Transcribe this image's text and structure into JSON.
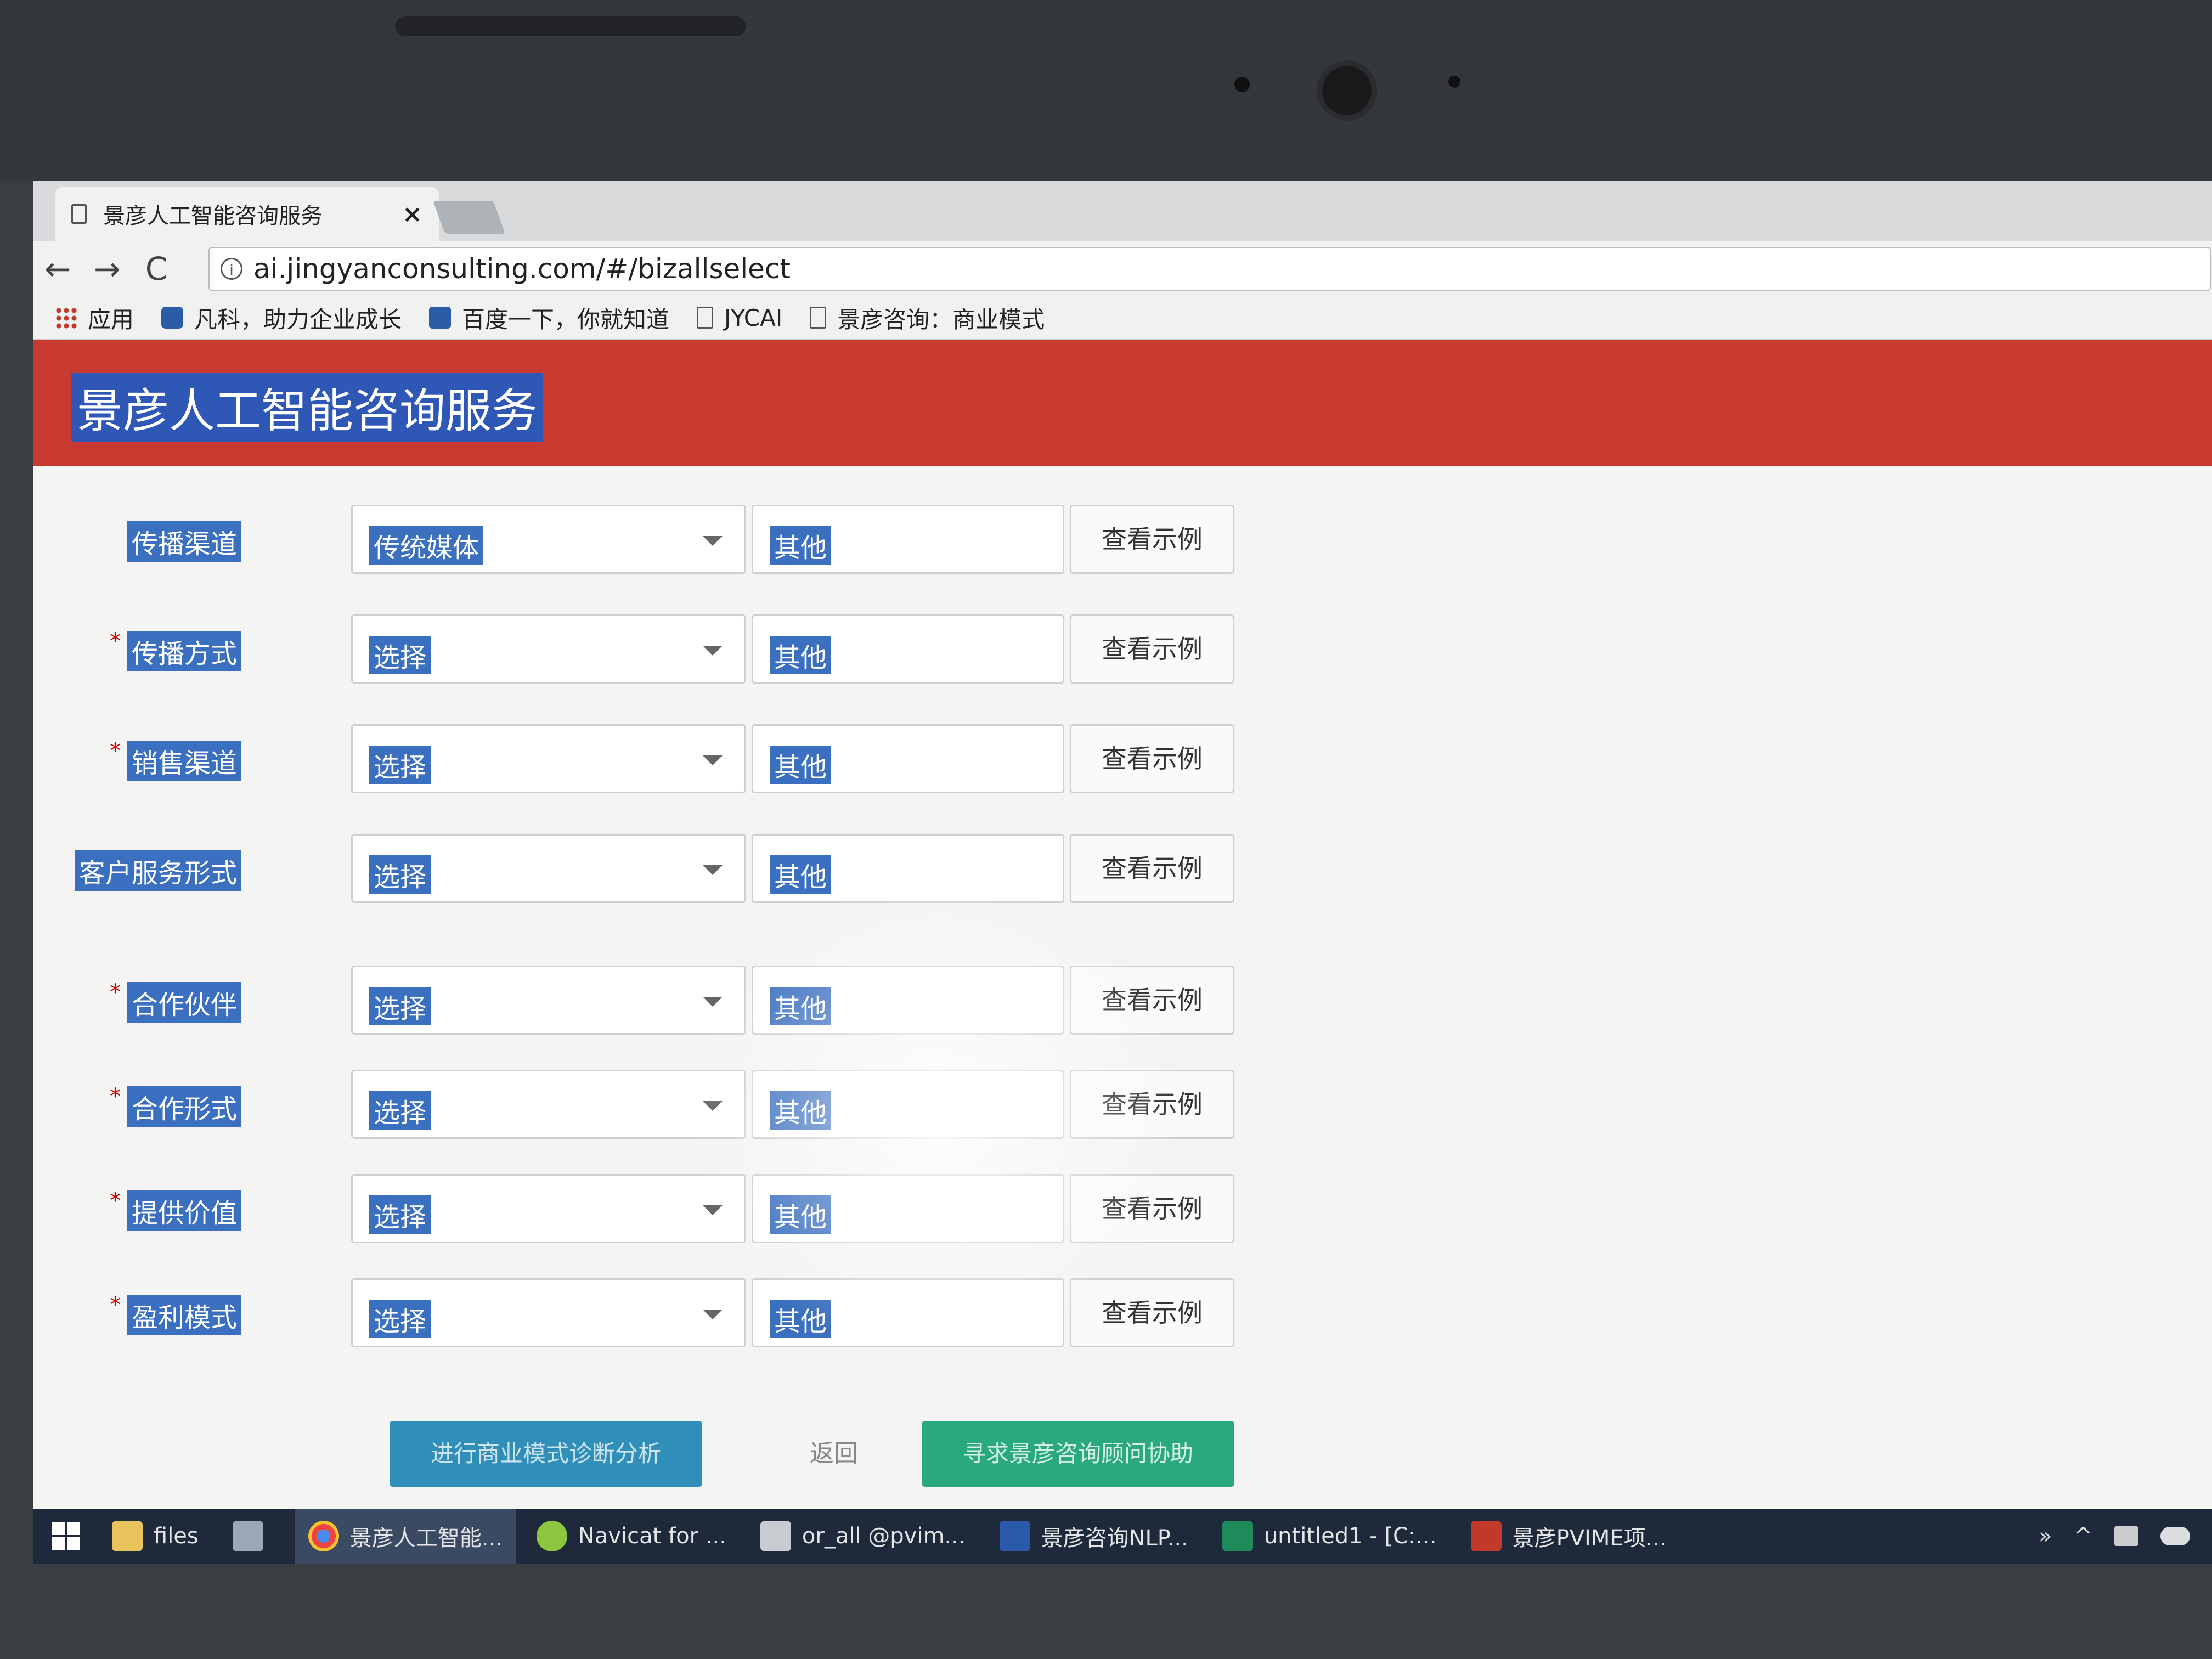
{
  "browser": {
    "tab_title": "景彦人工智能咨询服务",
    "tab_close": "×",
    "url": "ai.jingyanconsulting.com/#/bizallselect",
    "nav": {
      "back": "←",
      "forward": "→",
      "reload": "C"
    },
    "info_glyph": "i",
    "bookmarks": [
      {
        "label": "应用",
        "icon": "apps-grid-icon"
      },
      {
        "label": "凡科，助力企业成长",
        "icon": "fanke-icon"
      },
      {
        "label": "百度一下，你就知道",
        "icon": "baidu-icon"
      },
      {
        "label": "JYCAI",
        "icon": "page-icon"
      },
      {
        "label": "景彦咨询：商业模式",
        "icon": "page-icon"
      }
    ]
  },
  "app": {
    "title": "景彦人工智能咨询服务",
    "header_color": "#c8392f"
  },
  "form": {
    "rows": [
      {
        "label": "传播渠道",
        "required": "",
        "select": "传统媒体",
        "other": "其他",
        "example": "查看示例"
      },
      {
        "label": "传播方式",
        "required": "*",
        "select": "选择",
        "other": "其他",
        "example": "查看示例"
      },
      {
        "label": "销售渠道",
        "required": "*",
        "select": "选择",
        "other": "其他",
        "example": "查看示例"
      },
      {
        "label": "客户服务形式",
        "required": "*",
        "select": "选择",
        "other": "其他",
        "example": "查看示例"
      },
      {
        "label": "合作伙伴",
        "required": "*",
        "select": "选择",
        "other": "其他",
        "example": "查看示例"
      },
      {
        "label": "合作形式",
        "required": "*",
        "select": "选择",
        "other": "其他",
        "example": "查看示例"
      },
      {
        "label": "提供价值",
        "required": "*",
        "select": "选择",
        "other": "其他",
        "example": "查看示例"
      },
      {
        "label": "盈利模式",
        "required": "*",
        "select": "选择",
        "other": "其他",
        "example": "查看示例"
      }
    ],
    "buttons": {
      "analyze": "进行商业模式诊断分析",
      "back": "返回",
      "help": "寻求景彦咨询顾问协助"
    }
  },
  "taskbar": {
    "items": [
      {
        "label": "files",
        "icon": "folder-icon"
      },
      {
        "label": "",
        "icon": "app-icon"
      },
      {
        "label": "景彦人工智能...",
        "icon": "chrome-icon",
        "active": true
      },
      {
        "label": "Navicat for ...",
        "icon": "navicat-icon"
      },
      {
        "label": "or_all @pvim...",
        "icon": "database-icon"
      },
      {
        "label": "景彦咨询NLP...",
        "icon": "word-icon"
      },
      {
        "label": "untitled1 - [C:...",
        "icon": "pycharm-icon"
      },
      {
        "label": "景彦PVIME项...",
        "icon": "pdf-icon"
      }
    ],
    "tray": {
      "overflow": "»",
      "chevron": "^"
    }
  }
}
